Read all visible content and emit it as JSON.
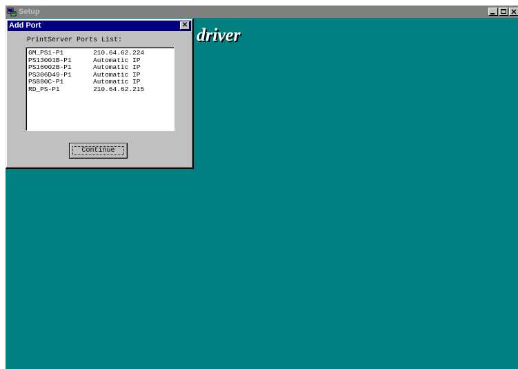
{
  "setup_window": {
    "title": "Setup",
    "controls": [
      "minimize-icon",
      "maximize-icon",
      "close-icon"
    ]
  },
  "banner": {
    "text": "driver"
  },
  "dialog": {
    "title": "Add Port",
    "close_glyph": "✕",
    "list_label": "PrintServer Ports List:",
    "ports": [
      {
        "name": "GM_PS1-P1",
        "address": "210.64.62.224"
      },
      {
        "name": "PS13001B-P1",
        "address": "Automatic IP"
      },
      {
        "name": "PS16002B-P1",
        "address": "Automatic IP"
      },
      {
        "name": "PS306D49-P1",
        "address": "Automatic IP"
      },
      {
        "name": "PS880C-P1",
        "address": "Automatic IP"
      },
      {
        "name": "RD_PS-P1",
        "address": "210.64.62.215"
      }
    ],
    "continue_label": "Continue"
  },
  "colors": {
    "desktop_teal": "#008080",
    "active_titlebar": "#000080",
    "inactive_titlebar": "#808080",
    "dialog_face": "#c0c0c0"
  }
}
